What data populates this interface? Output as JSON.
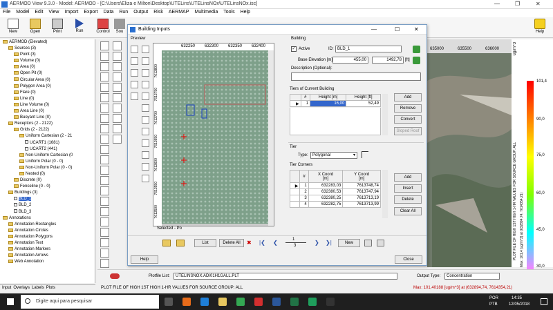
{
  "window": {
    "title": "AERMOD View 9.3.0 - Model: AERMOD - [C:\\Users\\Eliza e Milton\\Desktop\\UTELins\\UTELinsNOx\\UTELinsNOx.isc]"
  },
  "menu": [
    "File",
    "Model",
    "Edit",
    "View",
    "Import",
    "Export",
    "Data",
    "Run",
    "Output",
    "Risk",
    "AERMAP",
    "Multimedia",
    "Tools",
    "Help"
  ],
  "toolbar": {
    "new": "New",
    "open": "Open",
    "print": "Print",
    "run": "Run",
    "control": "Control",
    "sou": "Sou",
    "help": "Help"
  },
  "tree": [
    "AERMOD (Elevated)",
    "Sources (3)",
    "Point (3)",
    "Volume (0)",
    "Area (0)",
    "Open Pit (0)",
    "Circular Area (0)",
    "Polygon Area (0)",
    "Flare (0)",
    "Line (0)",
    "Line Volume (0)",
    "Area Line (0)",
    "Buoyant Line (0)",
    "Receptors (2 - 2122)",
    "Grids (2 - 2122)",
    "Uniform Cartesian (2 - 21",
    "UCART1 (1681)",
    "UCART2 (441)",
    "Non-Uniform Cartesian (0",
    "Uniform Polar (0 - 0)",
    "Non-Uniform Polar (0 - 0)",
    "Nested (0)",
    "Discrete (0)",
    "Fenceline (0 - 0)",
    "Buildings (3)",
    "BLD_1",
    "BLD_2",
    "BLD_3",
    "Annotations",
    "Annotation Rectangles",
    "Annotation Circles",
    "Annotation Polygons",
    "Annotation Text",
    "Annotation Markers",
    "Annotation Arrows",
    "Web Annotation"
  ],
  "tree_tabs": [
    "Input",
    "Overlays",
    "Labels",
    "Plots"
  ],
  "dialog": {
    "title": "Building Inputs",
    "preview_label": "Preview",
    "x_ticks": [
      "632250",
      "632300",
      "632350",
      "632400"
    ],
    "y_ticks": [
      "7613800",
      "7613750",
      "7613700",
      "7613650",
      "7613600",
      "7613550",
      "7613500"
    ],
    "selected": "Selected - Po",
    "building_group": "Building",
    "active_label": "Active",
    "id_label": "ID:",
    "id_value": "BLD_1",
    "base_elev_label": "Base Elevation [m]:",
    "base_elev_m": "455,00",
    "base_elev_ft": "1492,78",
    "ft_label": "[ft]",
    "desc_label": "Description (Optional):",
    "tiers_group": "Tiers of Current Building",
    "tiers_headers": [
      "#",
      "Height [m]",
      "Height [ft]"
    ],
    "tiers_rows": [
      [
        "1",
        "16,00",
        "52,49"
      ]
    ],
    "btn_add": "Add",
    "btn_remove": "Remove",
    "btn_convert": "Convert",
    "btn_sloped": "Sloped Roof",
    "tier_group": "Tier",
    "type_label": "Type:",
    "type_value": "Polygonal",
    "corners_label": "Tier Corners",
    "corner_headers": [
      "#",
      "X Coord\n[m]",
      "Y Coord\n[m]"
    ],
    "corner_rows": [
      [
        "1",
        "632283,03",
        "7613748,74"
      ],
      [
        "2",
        "632380,53",
        "7613747,94"
      ],
      [
        "3",
        "632380,25",
        "7613713,19"
      ],
      [
        "4",
        "632282,75",
        "7613713,99"
      ]
    ],
    "btn_cadd": "Add",
    "btn_insert": "Insert",
    "btn_delete": "Delete",
    "btn_clear": "Clear All",
    "btn_list": "List",
    "btn_delete_all": "Delete All",
    "page_num": "1",
    "page_total": "3",
    "btn_new": "New",
    "btn_help": "Help",
    "btn_close": "Close"
  },
  "map": {
    "x_ticks": [
      "635000",
      "635500",
      "636000"
    ],
    "legend_unit": "ug/m^3",
    "legend_values": [
      "101,4",
      "90,0",
      "75,0",
      "60,0",
      "45,0",
      "30,0"
    ],
    "legend_side": "PLOT FILE OF HIGH 1ST HIGH 1-HR VALUES FOR SOURCE GROUP: ALL",
    "legend_max": "Max: 101,4 [ug/m^3] at (632894,74, 7614354,21)",
    "colors": [
      "#ff0000",
      "#ff8000",
      "#ffff00",
      "#80ff00",
      "#00ffff",
      "#ff80ff"
    ]
  },
  "plotfile": {
    "label": "Plotfile List:",
    "value": "UTELINSNOX.AD\\01H1GALL.PLT",
    "output_label": "Output Type:",
    "output_value": "Concentration"
  },
  "status": {
    "left": "PLOT FILE OF HIGH 1ST HIGH 1-HR VALUES FOR SOURCE GROUP: ALL",
    "max": "Max:   101,40188  [ug/m^3]  at  (632894,74, 7614354,21)"
  },
  "taskbar": {
    "search": "Digite aqui para pesquisar",
    "lang1": "POR",
    "lang2": "PTB",
    "time": "14:35",
    "date": "12/05/2018"
  }
}
